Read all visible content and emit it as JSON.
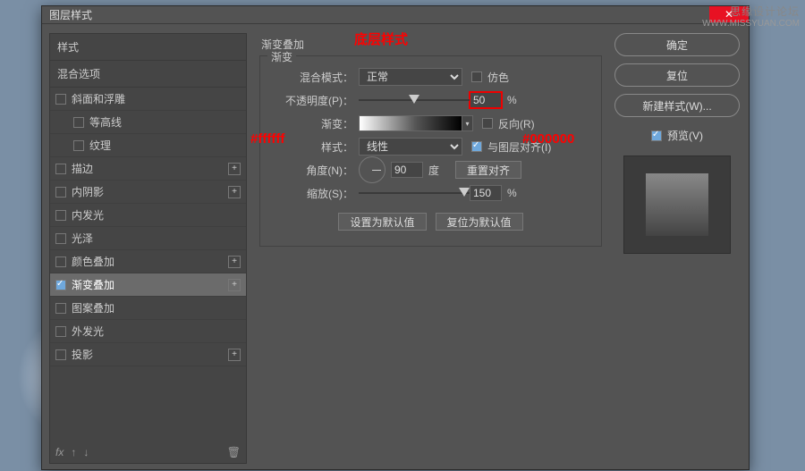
{
  "watermark": {
    "line1": "思缘设计论坛",
    "line2": "WWW.MISSYUAN.COM"
  },
  "dialog": {
    "title": "图层样式"
  },
  "left": {
    "header_styles": "样式",
    "header_blend": "混合选项",
    "items": [
      {
        "label": "斜面和浮雕",
        "checked": false
      },
      {
        "label": "等高线",
        "checked": false,
        "indent": true
      },
      {
        "label": "纹理",
        "checked": false,
        "indent": true
      },
      {
        "label": "描边",
        "checked": false,
        "plus": true
      },
      {
        "label": "内阴影",
        "checked": false,
        "plus": true
      },
      {
        "label": "内发光",
        "checked": false
      },
      {
        "label": "光泽",
        "checked": false
      },
      {
        "label": "颜色叠加",
        "checked": false,
        "plus": true
      },
      {
        "label": "渐变叠加",
        "checked": true,
        "plus": true,
        "selected": true
      },
      {
        "label": "图案叠加",
        "checked": false
      },
      {
        "label": "外发光",
        "checked": false
      },
      {
        "label": "投影",
        "checked": false,
        "plus": true
      }
    ],
    "fx": "fx"
  },
  "center": {
    "section_title": "渐变叠加",
    "legend": "渐变",
    "blend_label": "混合模式：",
    "blend_value": "正常",
    "dither_label": "仿色",
    "opacity_label": "不透明度(P)：",
    "opacity_value": "50",
    "opacity_suffix": "%",
    "gradient_label": "渐变：",
    "reverse_label": "反向(R)",
    "style_label": "样式：",
    "style_value": "线性",
    "align_label": "与图层对齐(I)",
    "angle_label": "角度(N)：",
    "angle_value": "90",
    "angle_suffix": "度",
    "reset_align": "重置对齐",
    "scale_label": "缩放(S)：",
    "scale_value": "150",
    "scale_suffix": "%",
    "set_default": "设置为默认值",
    "reset_default": "复位为默认值"
  },
  "right": {
    "ok": "确定",
    "cancel": "复位",
    "new_style": "新建样式(W)...",
    "preview": "预览(V)"
  },
  "anno": {
    "title": "底层样式",
    "left_hex": "#ffffff",
    "right_hex": "#000000"
  },
  "colors": {
    "red": "#e00"
  }
}
